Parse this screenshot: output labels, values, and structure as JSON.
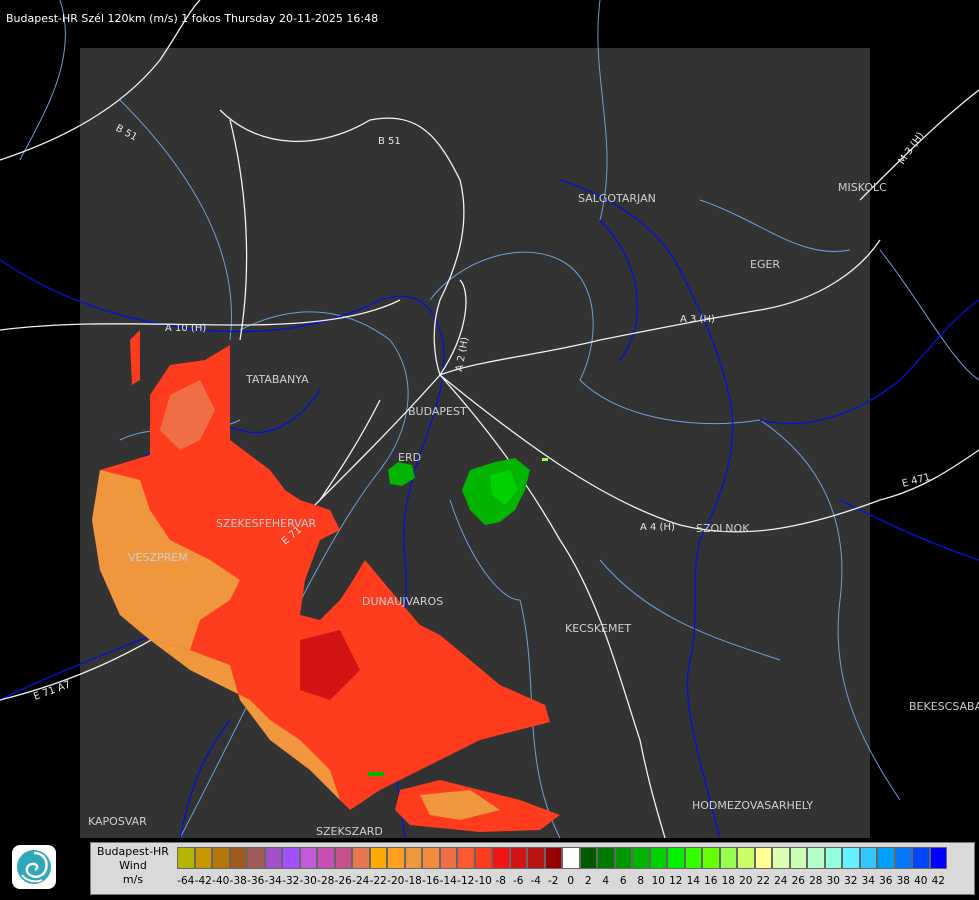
{
  "header": {
    "title": "Budapest-HR Szél 120km (m/s) 1 fokos Thursday 20-11-2025 16:48"
  },
  "cities": [
    {
      "name": "SALGOTARJAN"
    },
    {
      "name": "MISKOLC"
    },
    {
      "name": "EGER"
    },
    {
      "name": "TATABANYA"
    },
    {
      "name": "BUDAPEST"
    },
    {
      "name": "ERD"
    },
    {
      "name": "SZEKESFEHERVAR"
    },
    {
      "name": "VESZPREM"
    },
    {
      "name": "DUNAUJVAROS"
    },
    {
      "name": "KECSKEMET"
    },
    {
      "name": "SZOLNOK"
    },
    {
      "name": "BEKESCSABA"
    },
    {
      "name": "HODMEZOVASARHELY"
    },
    {
      "name": "KAPOSVAR"
    },
    {
      "name": "SZEKSZARD"
    }
  ],
  "roads": [
    {
      "name": "B 51"
    },
    {
      "name": "B 51"
    },
    {
      "name": "M 3 (H)"
    },
    {
      "name": "A 3 (H)"
    },
    {
      "name": "A 10 (H)"
    },
    {
      "name": "A 2 (H)"
    },
    {
      "name": "E 471"
    },
    {
      "name": "A 4 (H)"
    },
    {
      "name": "E 71"
    },
    {
      "name": "E 71 A7"
    }
  ],
  "legend": {
    "title_line1": "Budapest-HR",
    "title_line2": "Wind",
    "title_line3": "m/s",
    "logo_icon": "radar-service-logo-icon",
    "entries": [
      {
        "value": "-64",
        "color": "#b4b400"
      },
      {
        "value": "-42",
        "color": "#c89600"
      },
      {
        "value": "-40",
        "color": "#b4780a"
      },
      {
        "value": "-38",
        "color": "#a05a1e"
      },
      {
        "value": "-36",
        "color": "#a05a5a"
      },
      {
        "value": "-34",
        "color": "#a050c8"
      },
      {
        "value": "-32",
        "color": "#a050ff"
      },
      {
        "value": "-30",
        "color": "#c05ad8"
      },
      {
        "value": "-28",
        "color": "#c850b4"
      },
      {
        "value": "-26",
        "color": "#c8508c"
      },
      {
        "value": "-24",
        "color": "#e67850"
      },
      {
        "value": "-22",
        "color": "#ffaa00"
      },
      {
        "value": "-20",
        "color": "#ffa01e"
      },
      {
        "value": "-18",
        "color": "#f0963c"
      },
      {
        "value": "-16",
        "color": "#f08c3c"
      },
      {
        "value": "-14",
        "color": "#f06e46"
      },
      {
        "value": "-12",
        "color": "#ff5a32"
      },
      {
        "value": "-10",
        "color": "#ff3c1e"
      },
      {
        "value": "-8",
        "color": "#f01414"
      },
      {
        "value": "-6",
        "color": "#d21414"
      },
      {
        "value": "-4",
        "color": "#b41414"
      },
      {
        "value": "-2",
        "color": "#960000"
      },
      {
        "value": "0",
        "color": "#ffffff"
      },
      {
        "value": "2",
        "color": "#005a00"
      },
      {
        "value": "4",
        "color": "#007800"
      },
      {
        "value": "6",
        "color": "#009600"
      },
      {
        "value": "8",
        "color": "#00b400"
      },
      {
        "value": "10",
        "color": "#00d200"
      },
      {
        "value": "12",
        "color": "#00f000"
      },
      {
        "value": "14",
        "color": "#32ff00"
      },
      {
        "value": "16",
        "color": "#64ff00"
      },
      {
        "value": "18",
        "color": "#96ff50"
      },
      {
        "value": "20",
        "color": "#c8ff64"
      },
      {
        "value": "22",
        "color": "#ffff96"
      },
      {
        "value": "24",
        "color": "#dcffb4"
      },
      {
        "value": "26",
        "color": "#c8ffb4"
      },
      {
        "value": "28",
        "color": "#b4ffc8"
      },
      {
        "value": "30",
        "color": "#96ffdc"
      },
      {
        "value": "32",
        "color": "#64f0ff"
      },
      {
        "value": "34",
        "color": "#32c8ff"
      },
      {
        "value": "36",
        "color": "#00a0ff"
      },
      {
        "value": "38",
        "color": "#0078ff"
      },
      {
        "value": "40",
        "color": "#0046ff"
      },
      {
        "value": "42",
        "color": "#0000ff"
      }
    ]
  },
  "colors": {
    "background": "#000000",
    "radar_area": "#333333",
    "roads": "#ffffff",
    "rivers": "#0000ee",
    "borders": "#6f9fd8",
    "receding_wind": "#ff3c1e",
    "approaching_wind": "#00b400"
  }
}
